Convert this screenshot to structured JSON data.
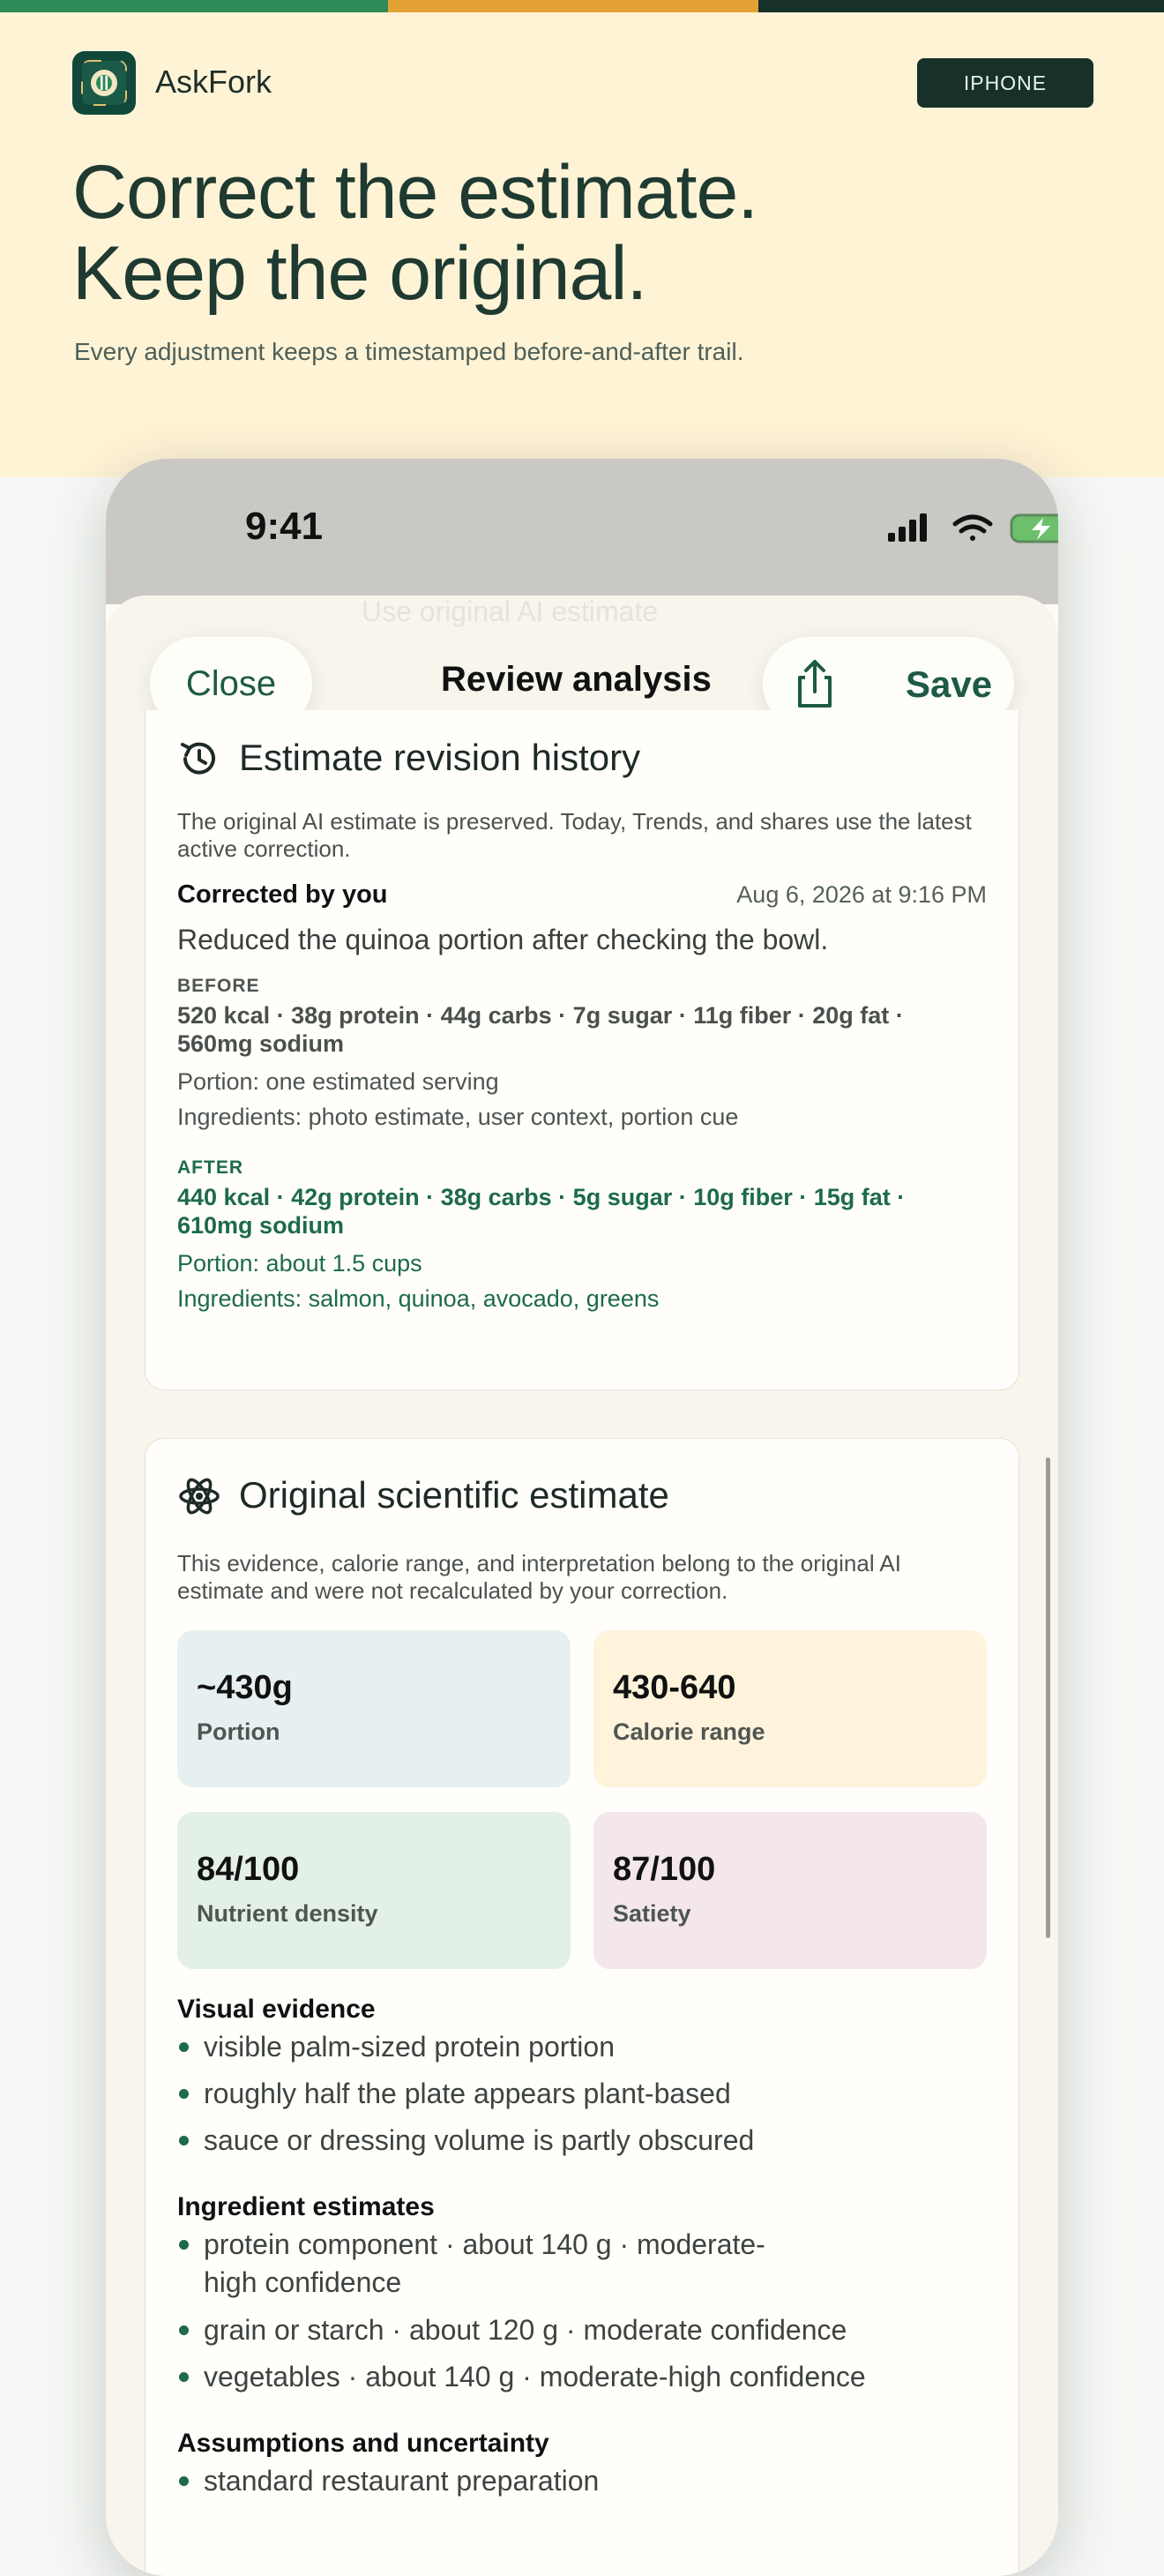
{
  "colors": {
    "stripe": [
      "#2e8b57",
      "#e3a233",
      "#17302a"
    ],
    "brand_green": "#1d6a4c",
    "hero_bg": "#fff3d6",
    "tile_portion": "#e6f0f0",
    "tile_calorie": "#fff3dc",
    "tile_nutrient": "#e3f0e6",
    "tile_satiety": "#f3e7ec"
  },
  "brand": {
    "name": "AskFork",
    "logo_icon": "fork-knife-plate-icon"
  },
  "platform": "IPHONE",
  "hero": {
    "headline_line1": "Correct the estimate.",
    "headline_line2": "Keep the original.",
    "subhead": "Every adjustment keeps a timestamped before-and-after trail."
  },
  "status_bar": {
    "time": "9:41",
    "icons": [
      "signal-icon",
      "wifi-icon",
      "battery-charging-icon"
    ]
  },
  "sheet": {
    "ghost_text": "Use original AI estimate",
    "close_label": "Close",
    "title": "Review analysis",
    "share_icon": "share-icon",
    "save_label": "Save"
  },
  "revision_card": {
    "title": "Estimate revision history",
    "icon": "history-icon",
    "description": "The original AI estimate is preserved. Today, Trends, and shares use the latest active correction.",
    "author": "Corrected by you",
    "timestamp": "Aug 6, 2026 at 9:16 PM",
    "note": "Reduced the quinoa portion after checking the bowl.",
    "before": {
      "label": "BEFORE",
      "macros": "520 kcal · 38g protein · 44g carbs · 7g sugar · 11g fiber · 20g fat · 560mg sodium",
      "portion": "Portion: one estimated serving",
      "ingredients": "Ingredients: photo estimate, user context, portion cue"
    },
    "after": {
      "label": "AFTER",
      "macros": "440 kcal · 42g protein · 38g carbs · 5g sugar · 10g fiber · 15g fat · 610mg sodium",
      "portion": "Portion: about 1.5 cups",
      "ingredients": "Ingredients: salmon, quinoa, avocado, greens"
    }
  },
  "original_card": {
    "title": "Original scientific estimate",
    "icon": "atom-icon",
    "description": "This evidence, calorie range, and interpretation belong to the original AI estimate and were not recalculated by your correction.",
    "tiles": [
      {
        "value": "~430g",
        "label": "Portion"
      },
      {
        "value": "430-640",
        "label": "Calorie range"
      },
      {
        "value": "84/100",
        "label": "Nutrient density"
      },
      {
        "value": "87/100",
        "label": "Satiety"
      }
    ],
    "visual_evidence": {
      "heading": "Visual evidence",
      "items": [
        "visible palm-sized protein portion",
        "roughly half the plate appears plant-based",
        "sauce or dressing volume is partly obscured"
      ]
    },
    "ingredient_estimates": {
      "heading": "Ingredient estimates",
      "items": [
        "protein component · about 140 g · moderate-",
        "high confidence",
        "grain or starch · about 120 g · moderate confidence",
        "vegetables · about 140 g · moderate-high confidence"
      ]
    },
    "assumptions": {
      "heading": "Assumptions and uncertainty",
      "items": [
        "standard restaurant preparation"
      ]
    }
  }
}
